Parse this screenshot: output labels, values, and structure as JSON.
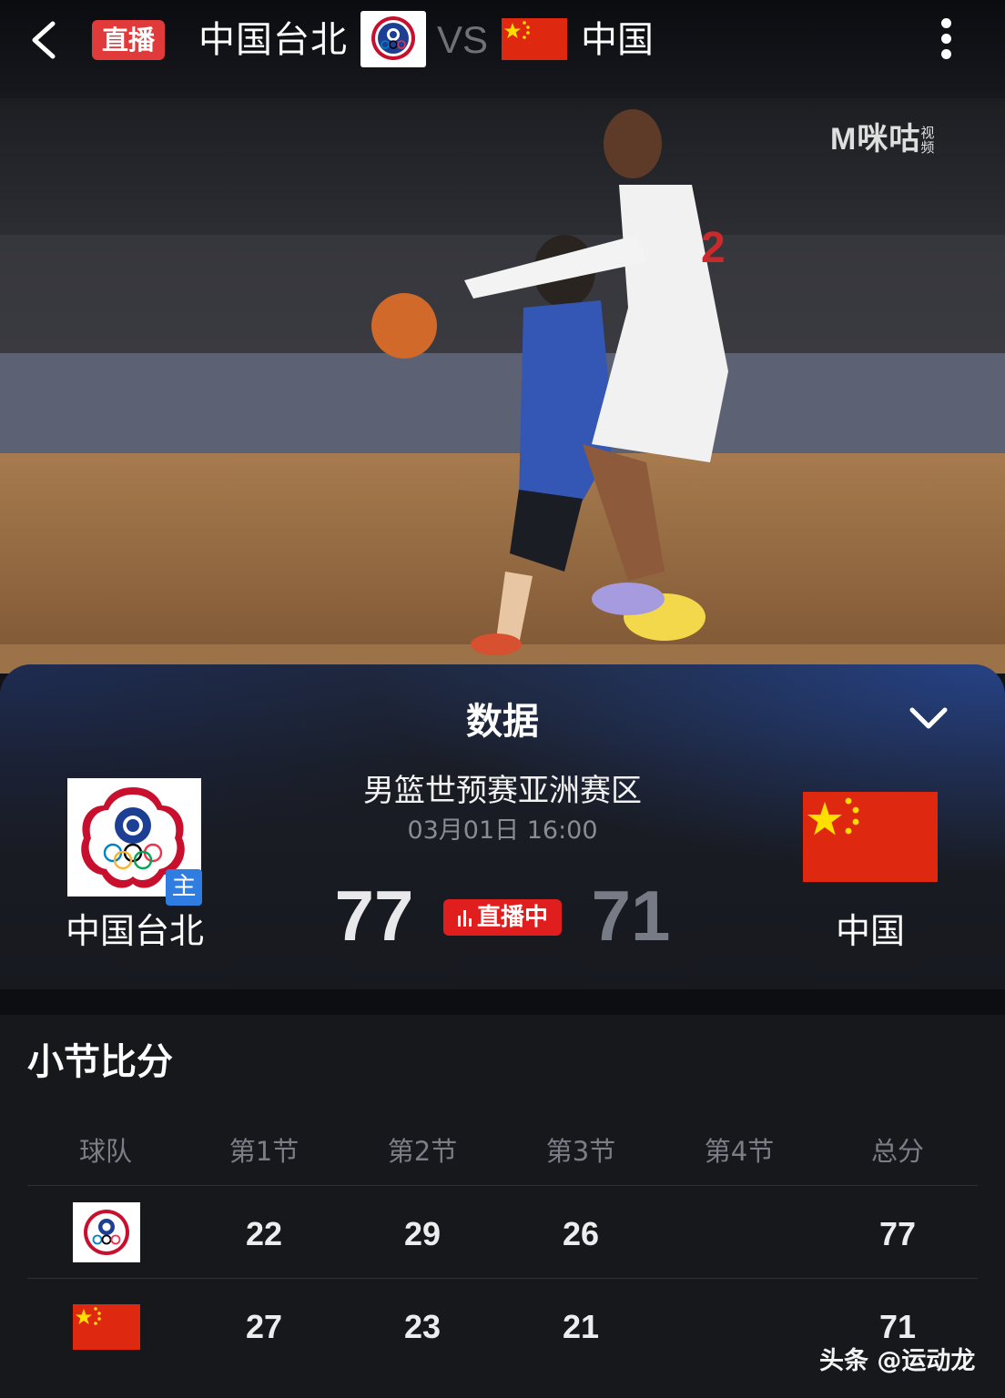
{
  "topbar": {
    "live_tag": "直播",
    "team_left": "中国台北",
    "vs": "VS",
    "team_right": "中国"
  },
  "video": {
    "watermark": "咪咕",
    "watermark_brand": "M",
    "watermark_sub": "视频"
  },
  "panel": {
    "title": "数据",
    "league": "男篮世预赛亚洲赛区",
    "datetime": "03月01日 16:00",
    "home_badge": "主",
    "home_team": "中国台北",
    "away_team": "中国",
    "home_score": "77",
    "away_score": "71",
    "status": "直播中"
  },
  "quarters": {
    "title": "小节比分",
    "headers": [
      "球队",
      "第1节",
      "第2节",
      "第3节",
      "第4节",
      "总分"
    ],
    "rows": [
      {
        "team_icon": "chinese-taipei-flag-icon",
        "q1": "22",
        "q2": "29",
        "q3": "26",
        "q4": "",
        "total": "77"
      },
      {
        "team_icon": "china-flag-icon",
        "q1": "27",
        "q2": "23",
        "q3": "21",
        "q4": "",
        "total": "71"
      }
    ]
  },
  "footer": {
    "credit": "头条 @运动龙"
  },
  "colors": {
    "live_red": "#e01e1e",
    "home_badge_blue": "#2f7de1",
    "china_red": "#de2910",
    "background": "#121317"
  }
}
